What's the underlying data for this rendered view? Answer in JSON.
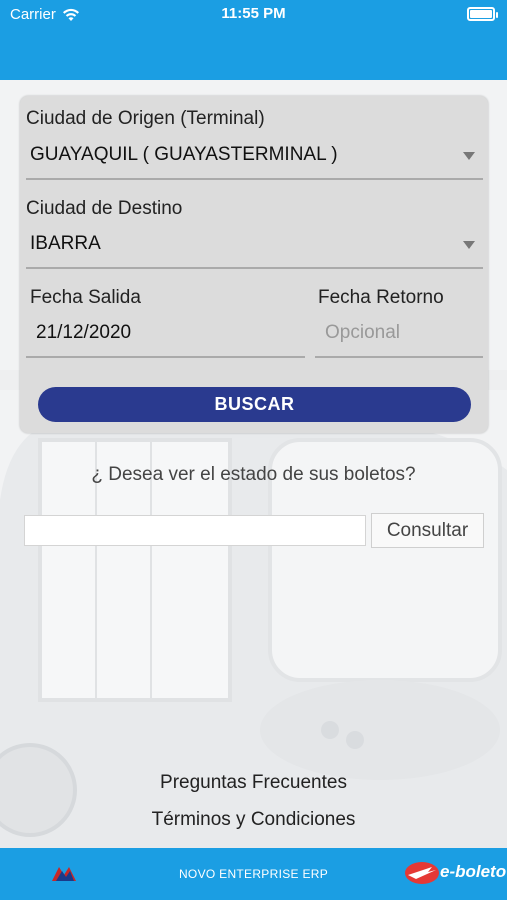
{
  "status_bar": {
    "carrier": "Carrier",
    "time": "11:55 PM",
    "wifi_icon": "wifi-icon",
    "battery_icon": "battery-icon"
  },
  "form": {
    "origin_label": "Ciudad de Origen (Terminal)",
    "origin_value": "GUAYAQUIL ( GUAYASTERMINAL )",
    "destination_label": "Ciudad de Destino",
    "destination_value": "IBARRA",
    "departure_label": "Fecha Salida",
    "departure_value": "21/12/2020",
    "return_label": "Fecha Retorno",
    "return_placeholder": "Opcional",
    "search_button": "BUSCAR"
  },
  "ticket_status": {
    "prompt": "¿ Desea ver el estado de sus boletos?",
    "input_value": "",
    "consult_button": "Consultar"
  },
  "links": {
    "faq": "Preguntas Frecuentes",
    "terms": "Términos y Condiciones"
  },
  "footer": {
    "company": "NOVO ENTERPRISE ERP",
    "brand": "e-boleto"
  },
  "colors": {
    "header": "#1b9ee3",
    "button": "#2a3a8f"
  }
}
